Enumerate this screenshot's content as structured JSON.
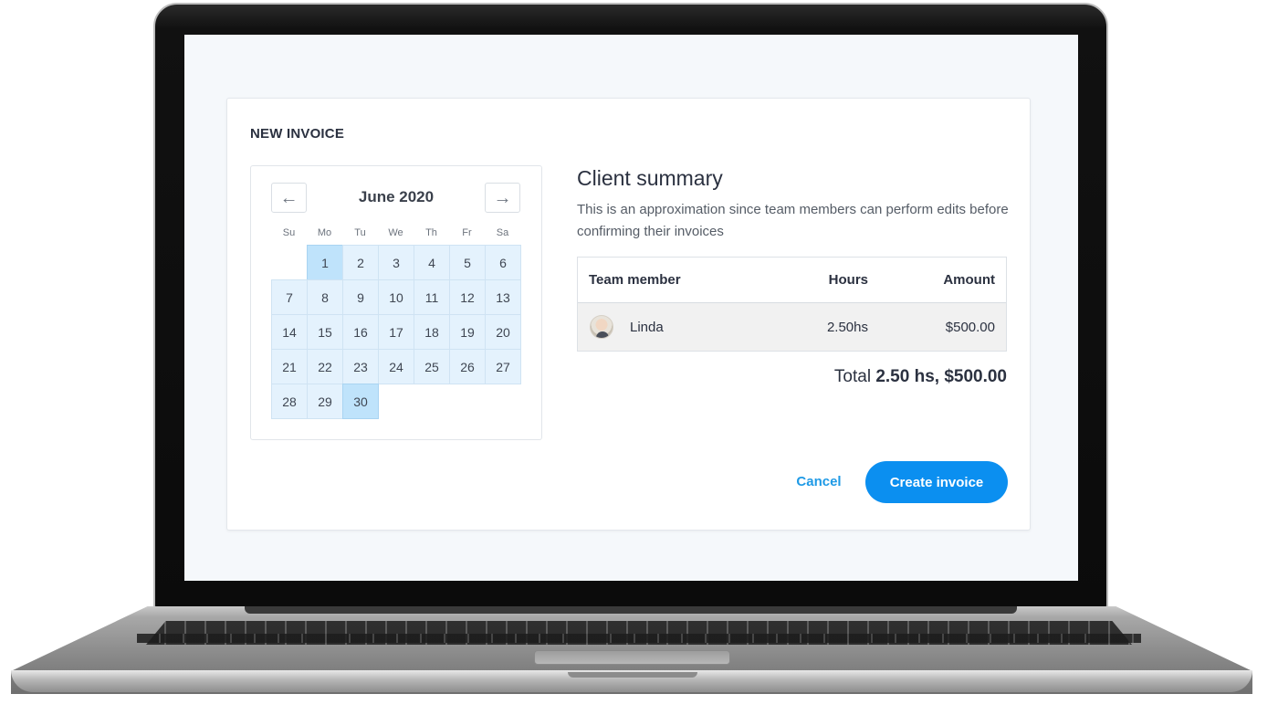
{
  "invoice": {
    "title": "NEW INVOICE"
  },
  "calendar": {
    "month_label": "June 2020",
    "prev_icon": "arrow-left-icon",
    "next_icon": "arrow-right-icon",
    "weekdays": [
      "Su",
      "Mo",
      "Tu",
      "We",
      "Th",
      "Fr",
      "Sa"
    ],
    "leading_blanks": 1,
    "days": [
      "1",
      "2",
      "3",
      "4",
      "5",
      "6",
      "7",
      "8",
      "9",
      "10",
      "11",
      "12",
      "13",
      "14",
      "15",
      "16",
      "17",
      "18",
      "19",
      "20",
      "21",
      "22",
      "23",
      "24",
      "25",
      "26",
      "27",
      "28",
      "29",
      "30"
    ],
    "range_start": "1",
    "range_end": "30",
    "range_color": "#e4f2fd",
    "endpoint_color": "#bfe3fb"
  },
  "summary": {
    "title": "Client summary",
    "description": "This is an approximation since team members can perform edits before confirming their invoices",
    "columns": {
      "member": "Team member",
      "hours": "Hours",
      "amount": "Amount"
    },
    "rows": [
      {
        "member": "Linda",
        "hours": "2.50hs",
        "amount": "$500.00",
        "avatar": "avatar-photo"
      }
    ],
    "total_label": "Total",
    "total_value": "2.50 hs, $500.00"
  },
  "actions": {
    "cancel_label": "Cancel",
    "create_label": "Create invoice",
    "accent_color": "#0b8ff0"
  }
}
